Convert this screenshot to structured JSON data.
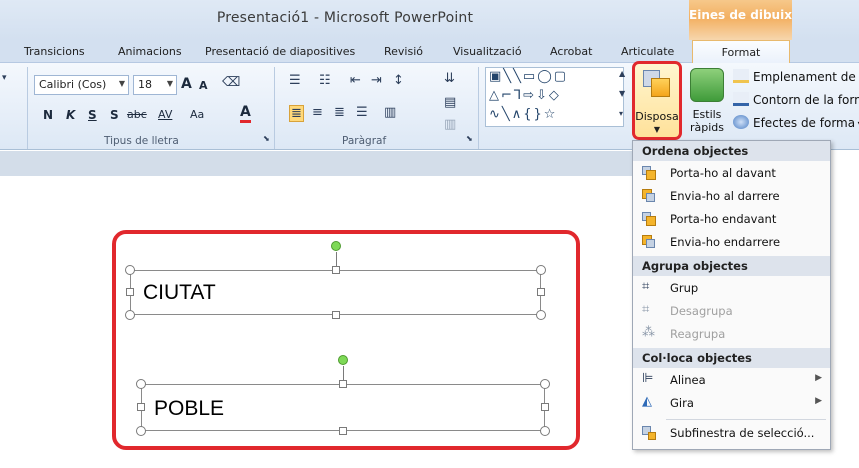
{
  "window": {
    "title": "Presentació1 - Microsoft PowerPoint",
    "context_tab_header": "Eines de dibuix"
  },
  "tabs": [
    "Transicions",
    "Animacions",
    "Presentació de diapositives",
    "Revisió",
    "Visualització",
    "Acrobat",
    "Articulate",
    "Format"
  ],
  "ribbon": {
    "font": {
      "name": "Calibri (Cos)",
      "size": "18",
      "bold": "N",
      "italic": "K",
      "underline": "S",
      "strike": "S",
      "strike2": "abc",
      "spacing": "AV",
      "case": "Aa",
      "color": "A",
      "grow": "A",
      "shrink": "A",
      "group_label": "Tipus de lletra"
    },
    "paragraph": {
      "group_label": "Paràgraf"
    },
    "arrange": {
      "label": "Disposa"
    },
    "styles": {
      "label_line1": "Estils",
      "label_line2": "ràpids"
    },
    "format_items": [
      "Emplenament de fo",
      "Contorn de la forma",
      "Efectes de forma"
    ]
  },
  "slide": {
    "textboxes": [
      "CIUTAT",
      "POBLE"
    ]
  },
  "menu": {
    "sections": [
      {
        "header": "Ordena objectes",
        "items": [
          {
            "label": "Porta-ho al davant",
            "icon": "bring-to-front-icon",
            "enabled": true
          },
          {
            "label": "Envia-ho al darrere",
            "icon": "send-to-back-icon",
            "enabled": true
          },
          {
            "label": "Porta-ho endavant",
            "icon": "bring-forward-icon",
            "enabled": true
          },
          {
            "label": "Envia-ho endarrere",
            "icon": "send-backward-icon",
            "enabled": true
          }
        ]
      },
      {
        "header": "Agrupa objectes",
        "items": [
          {
            "label": "Grup",
            "icon": "group-icon",
            "enabled": true
          },
          {
            "label": "Desagrupa",
            "icon": "ungroup-icon",
            "enabled": false
          },
          {
            "label": "Reagrupa",
            "icon": "regroup-icon",
            "enabled": false
          }
        ]
      },
      {
        "header": "Col·loca objectes",
        "items": [
          {
            "label": "Alinea",
            "icon": "align-icon",
            "enabled": true,
            "submenu": true
          },
          {
            "label": "Gira",
            "icon": "rotate-icon",
            "enabled": true,
            "submenu": true
          }
        ]
      }
    ],
    "footer_item": {
      "label": "Subfinestra de selecció...",
      "icon": "selection-pane-icon"
    }
  },
  "colors": {
    "highlight_red": "#e1282d",
    "context_orange": "#f3b062",
    "ribbon_blue": "#dde8f5"
  }
}
